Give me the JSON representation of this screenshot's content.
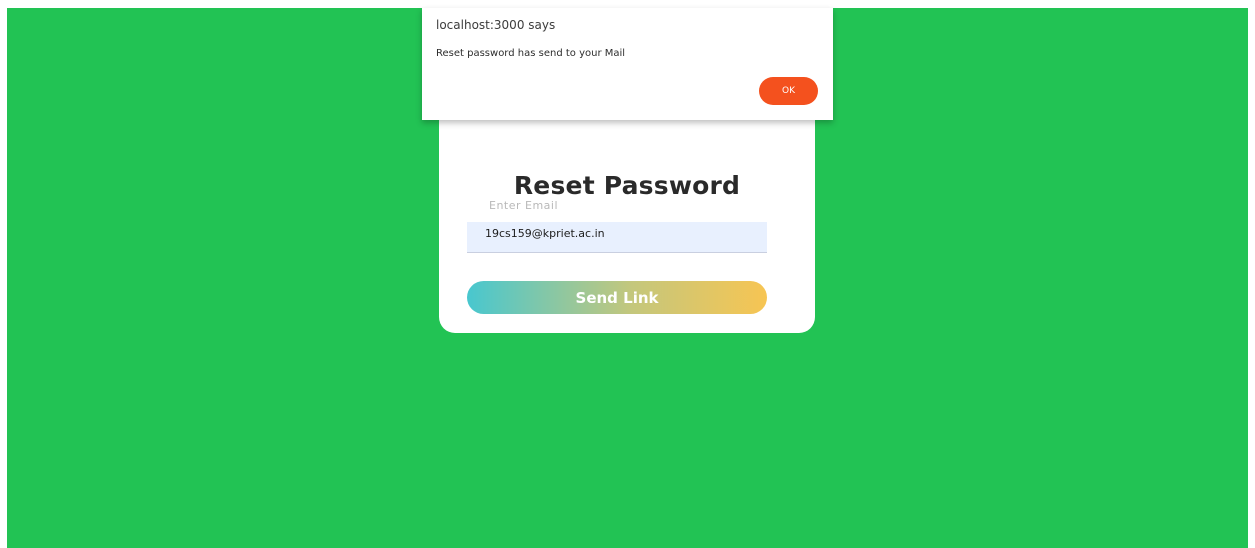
{
  "page": {
    "background_color": "#22c354"
  },
  "reset_form": {
    "title": "Reset Password",
    "email_label": "Enter Email",
    "email_value": "19cs159@kpriet.ac.in",
    "send_button_label": "Send Link"
  },
  "alert_dialog": {
    "title": "localhost:3000 says",
    "message": "Reset password has send to your Mail",
    "ok_label": "OK",
    "ok_color": "#f4511e"
  }
}
